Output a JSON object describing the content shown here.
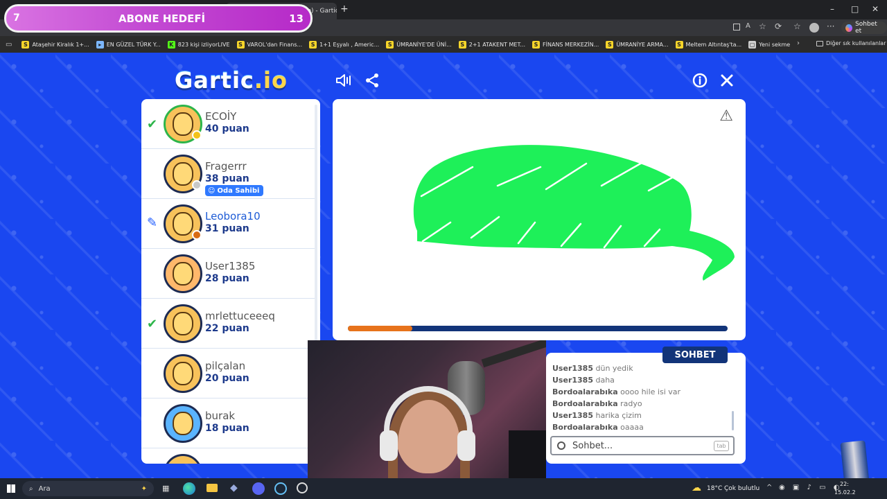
{
  "browser": {
    "tabs": [
      "Genel #SOv2pQ (Türkçe) - Gartic.io"
    ],
    "window_controls": [
      "–",
      "□",
      "✕"
    ],
    "bookmarks": [
      {
        "label": "Ataşehir Kiralık 1+...",
        "icon": "S",
        "color": "#f7d52a"
      },
      {
        "label": "EN GÜZEL TÜRK Y...",
        "icon": "▸",
        "color": "#7cb7ff"
      },
      {
        "label": "823 kişi izliyorLIVE",
        "icon": "K",
        "color": "#53fc18"
      },
      {
        "label": "VAROL'dan Finans...",
        "icon": "S",
        "color": "#f7d52a"
      },
      {
        "label": "1+1 Eşyalı , Americ...",
        "icon": "S",
        "color": "#f7d52a"
      },
      {
        "label": "ÜMRANİYE'DE ÜNİ...",
        "icon": "S",
        "color": "#f7d52a"
      },
      {
        "label": "2+1 ATAKENT MET...",
        "icon": "S",
        "color": "#f7d52a"
      },
      {
        "label": "FİNANS MERKEZİN...",
        "icon": "S",
        "color": "#f7d52a"
      },
      {
        "label": "ÜMRANİYE ARMA...",
        "icon": "S",
        "color": "#f7d52a"
      },
      {
        "label": "Meltem Altıntaş'ta...",
        "icon": "S",
        "color": "#f7d52a"
      },
      {
        "label": "Yeni sekme",
        "icon": "▢",
        "color": "#cfcfcf"
      }
    ],
    "bookmarks_more": "Diğer sık kullanılanlar",
    "copilot_label": "Sohbet et"
  },
  "overlay": {
    "alert_left": "7",
    "alert_title": "ABONE HEDEFİ",
    "alert_right": "13"
  },
  "game": {
    "logo_main": "Gartic",
    "logo_suffix": ".io",
    "players": [
      {
        "name": "ECOİY",
        "score": "40 puan",
        "status": "check",
        "dot": "#f2c21a"
      },
      {
        "name": "Fragerrr",
        "score": "38 puan",
        "status": "none",
        "dot": "#c8c8c8",
        "badge": "Oda Sahibi"
      },
      {
        "name": "Leobora10",
        "score": "31 puan",
        "status": "drawing",
        "dot": "#d86b14"
      },
      {
        "name": "User1385",
        "score": "28 puan",
        "status": "none",
        "dot": null
      },
      {
        "name": "mrlettuceeeq",
        "score": "22 puan",
        "status": "check",
        "dot": null
      },
      {
        "name": "pilçalan",
        "score": "20 puan",
        "status": "none",
        "dot": null
      },
      {
        "name": "burak",
        "score": "18 puan",
        "status": "none",
        "dot": null
      }
    ],
    "drawing_colors": {
      "leaf": "#1ef059"
    },
    "timer_fraction": 0.17,
    "chat_tab": "SOHBET",
    "chat": [
      {
        "user": "User1385",
        "text": "dün yedik"
      },
      {
        "user": "User1385",
        "text": "daha"
      },
      {
        "user": "Bordoalarabıka",
        "text": "oooo hile isi var"
      },
      {
        "user": "Bordoalarabıka",
        "text": "radyo"
      },
      {
        "user": "User1385",
        "text": "harika çizim"
      },
      {
        "user": "Bordoalarabıka",
        "text": "oaaaa"
      }
    ],
    "chat_placeholder": "Sohbet...",
    "chat_key": "tab"
  },
  "taskbar": {
    "search": "Ara",
    "weather": "18°C",
    "weather_desc": "Çok bulutlu",
    "time": "22:",
    "date": "15.02.2"
  }
}
